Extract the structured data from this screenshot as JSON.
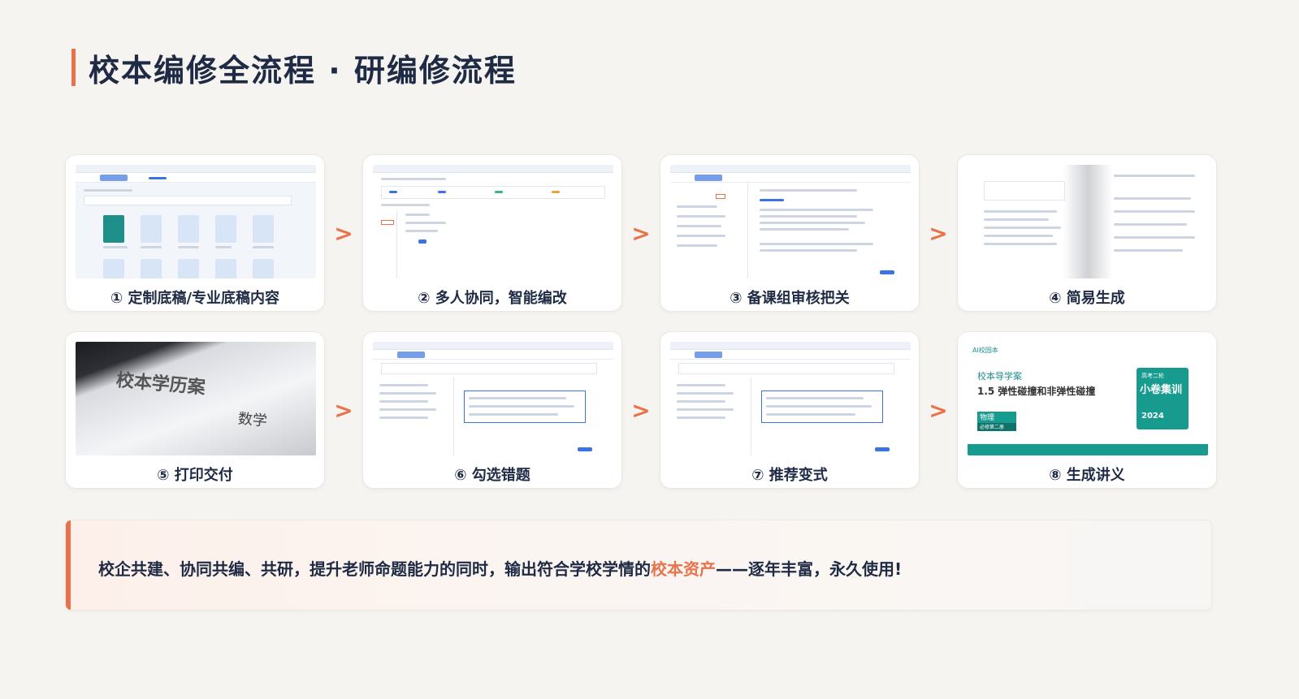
{
  "title": "校本编修全流程 · 研编修流程",
  "steps": [
    {
      "label": "① 定制底稿/专业底稿内容"
    },
    {
      "label": "② 多人协同，智能编改"
    },
    {
      "label": "③ 备课组审核把关"
    },
    {
      "label": "④ 简易生成"
    },
    {
      "label": "⑤ 打印交付"
    },
    {
      "label": "⑥ 勾选错题"
    },
    {
      "label": "⑦ 推荐变式"
    },
    {
      "label": "⑧ 生成讲义"
    }
  ],
  "arrow_glyph": ">",
  "photo": {
    "text1": "校本学历案",
    "text2": "数学"
  },
  "cover": {
    "ai": "AI校园本",
    "heading": "校本导学案",
    "lesson": "1.5 弹性碰撞和非弹性碰撞",
    "subject": "物理",
    "volume": "必修第二册",
    "book_top": "高考二轮",
    "book_title": "小卷集训",
    "book_year": "2024"
  },
  "banner": {
    "before": "校企共建、协同共编、共研，提升老师命题能力的同时，输出符合学校学情的",
    "highlight": "校本资产",
    "after": "——逐年丰富，永久使用!"
  },
  "colors": {
    "accent": "#e8734a",
    "navy": "#1f2a44",
    "teal": "#169b8e"
  }
}
